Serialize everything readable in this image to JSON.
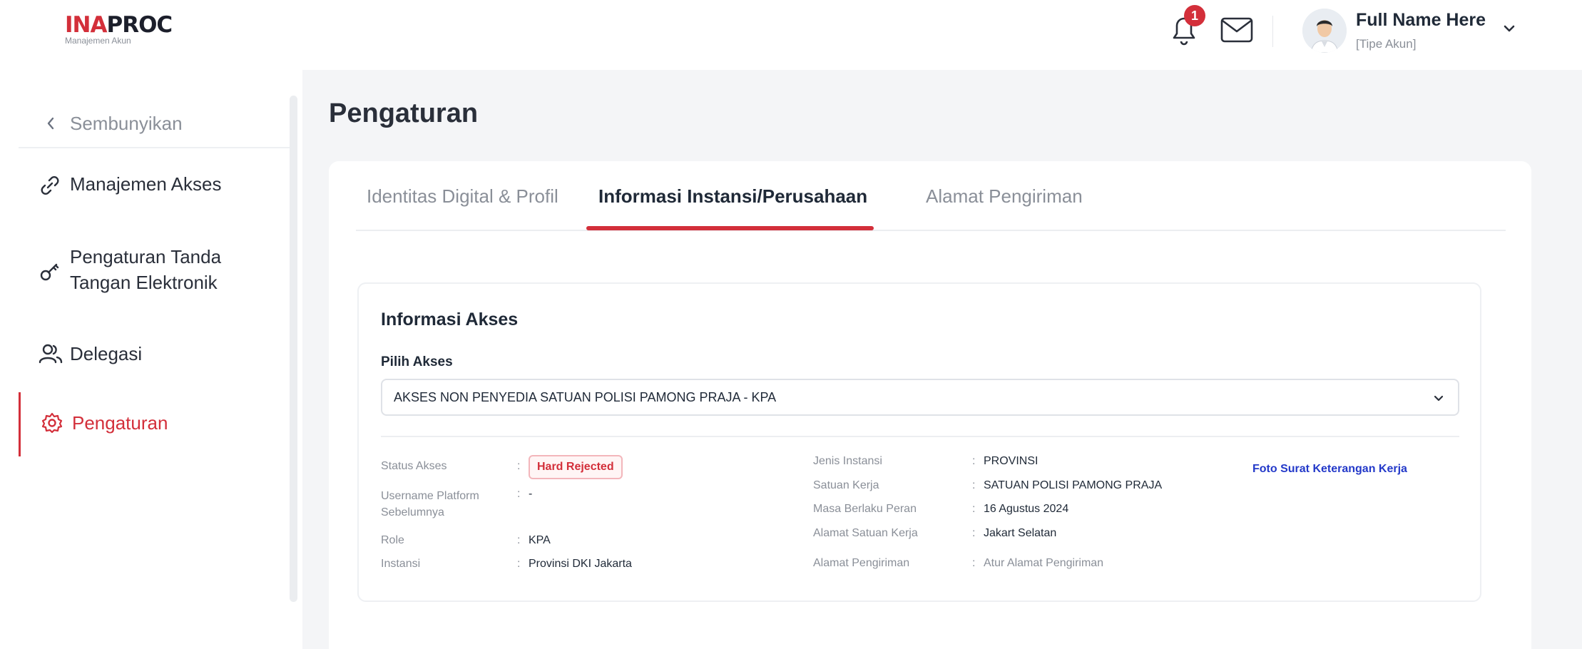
{
  "header": {
    "logo_ina": "INA",
    "logo_proc": "PROC",
    "logo_sub": "Manajemen Akun",
    "notification_count": "1",
    "user_name": "Full Name Here",
    "user_type": "[Tipe Akun]"
  },
  "sidebar": {
    "hide_label": "Sembunyikan",
    "items": [
      {
        "label": "Manajemen Akses",
        "icon": "link-icon"
      },
      {
        "label": "Pengaturan Tanda Tangan Elektronik",
        "icon": "key-icon"
      },
      {
        "label": "Delegasi",
        "icon": "users-icon"
      },
      {
        "label": "Pengaturan",
        "icon": "gear-icon",
        "active": true
      }
    ]
  },
  "main": {
    "title": "Pengaturan",
    "tabs": [
      {
        "label": "Identitas Digital & Profil"
      },
      {
        "label": "Informasi Instansi/Perusahaan",
        "active": true
      },
      {
        "label": "Alamat Pengiriman"
      }
    ],
    "section": {
      "title": "Informasi Akses",
      "select_label": "Pilih Akses",
      "select_value": "AKSES NON PENYEDIA SATUAN POLISI PAMONG PRAJA - KPA",
      "left_fields": [
        {
          "label": "Status Akses",
          "value": "Hard Rejected"
        },
        {
          "label": "Username Platform Sebelumnya",
          "value": "-"
        },
        {
          "label": "Role",
          "value": "KPA"
        },
        {
          "label": "Instansi",
          "value": "Provinsi DKI Jakarta"
        }
      ],
      "right_fields": [
        {
          "label": "Jenis Instansi",
          "value": "PROVINSI"
        },
        {
          "label": "Satuan Kerja",
          "value": "SATUAN POLISI PAMONG PRAJA"
        },
        {
          "label": "Masa Berlaku Peran",
          "value": "16 Agustus 2024"
        },
        {
          "label": "Alamat Satuan Kerja",
          "value": "Jakart Selatan"
        },
        {
          "label": "Alamat Pengiriman",
          "value": "Atur Alamat Pengiriman"
        }
      ],
      "doc_link": "Foto Surat Keterangan Kerja",
      "separator": ":"
    }
  },
  "colors": {
    "accent": "#d32f3a",
    "link": "#2339c9",
    "background": "#f4f5f7"
  }
}
